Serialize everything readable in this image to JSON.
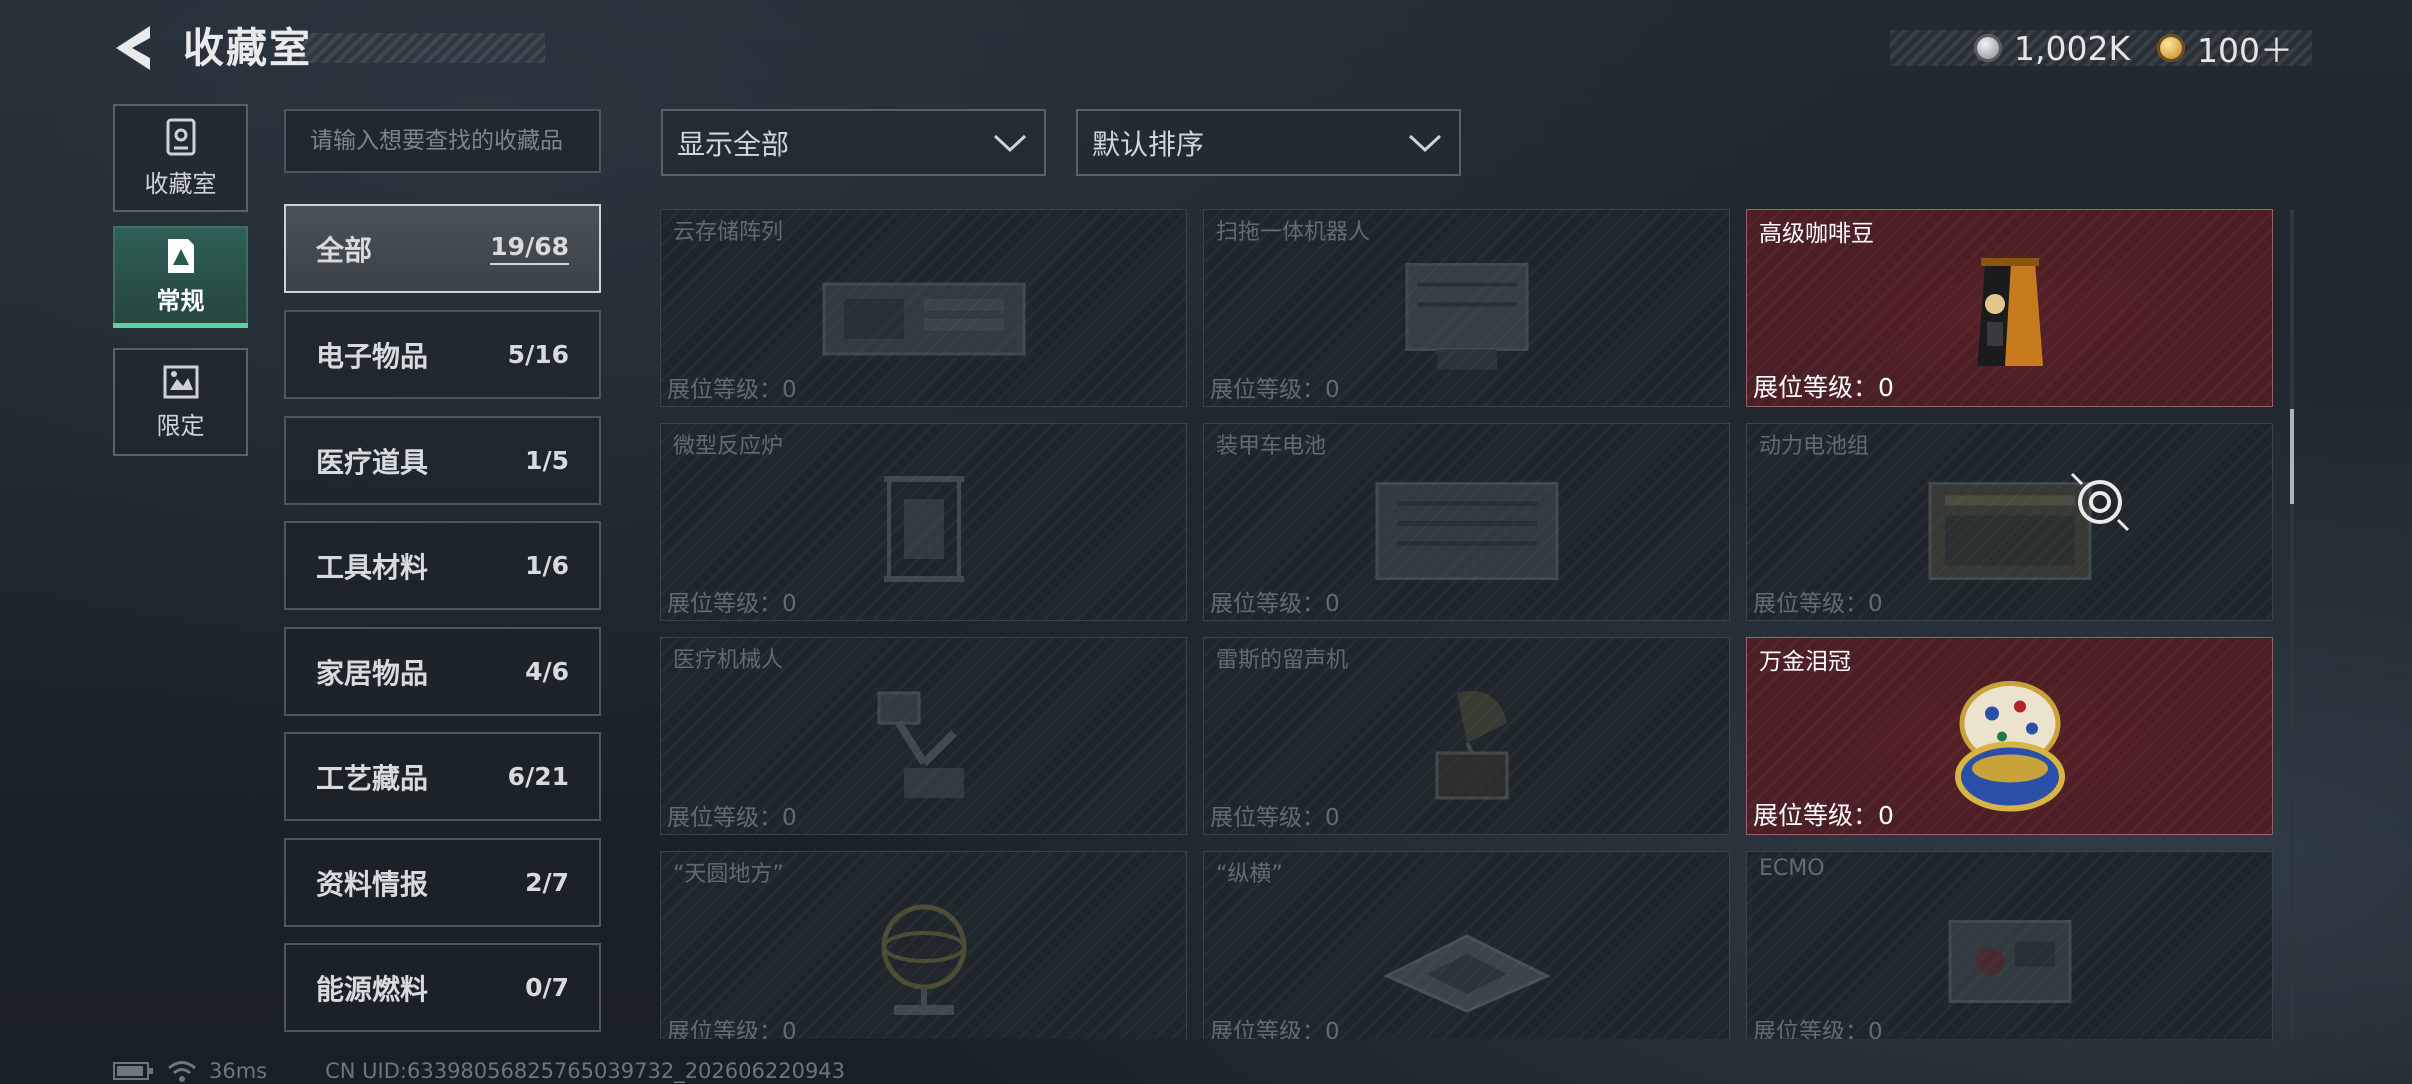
{
  "header": {
    "title": "收藏室"
  },
  "currency": [
    {
      "icon": "silver-coin-icon",
      "value": "1,002K",
      "color": "#c9ccd0"
    },
    {
      "icon": "gold-coin-icon",
      "value": "100＋",
      "color": "#d8a64a"
    }
  ],
  "nav": [
    {
      "label": "收藏室",
      "icon": "locker-icon",
      "active": false
    },
    {
      "label": "常规",
      "icon": "collection-icon",
      "active": true
    },
    {
      "label": "限定",
      "icon": "limited-icon",
      "active": false
    }
  ],
  "search": {
    "placeholder": "请输入想要查找的收藏品"
  },
  "categories": [
    {
      "name": "全部",
      "count": "19/68",
      "active": true
    },
    {
      "name": "电子物品",
      "count": "5/16"
    },
    {
      "name": "医疗道具",
      "count": "1/5"
    },
    {
      "name": "工具材料",
      "count": "1/6"
    },
    {
      "name": "家居物品",
      "count": "4/6"
    },
    {
      "name": "工艺藏品",
      "count": "6/21"
    },
    {
      "name": "资料情报",
      "count": "2/7"
    },
    {
      "name": "能源燃料",
      "count": "0/7"
    }
  ],
  "filters": {
    "display": "显示全部",
    "sort": "默认排序"
  },
  "level_label": "展位等级：0",
  "items": [
    {
      "name": "云存储阵列",
      "owned": false
    },
    {
      "name": "扫拖一体机器人",
      "owned": false
    },
    {
      "name": "高级咖啡豆",
      "owned": true
    },
    {
      "name": "微型反应炉",
      "owned": false
    },
    {
      "name": "装甲车电池",
      "owned": false
    },
    {
      "name": "动力电池组",
      "owned": false
    },
    {
      "name": "医疗机械人",
      "owned": false
    },
    {
      "name": "雷斯的留声机",
      "owned": false
    },
    {
      "name": "万金泪冠",
      "owned": true
    },
    {
      "name": "“天圆地方”",
      "owned": false
    },
    {
      "name": "“纵横”",
      "owned": false
    },
    {
      "name": "ECMO",
      "owned": false
    }
  ],
  "status": {
    "ping": "36ms",
    "uid": "CN UID:63398056825765039732_202606220943"
  },
  "colors": {
    "accent": "#5fd0a4",
    "owned_card": "#4b1f24"
  }
}
